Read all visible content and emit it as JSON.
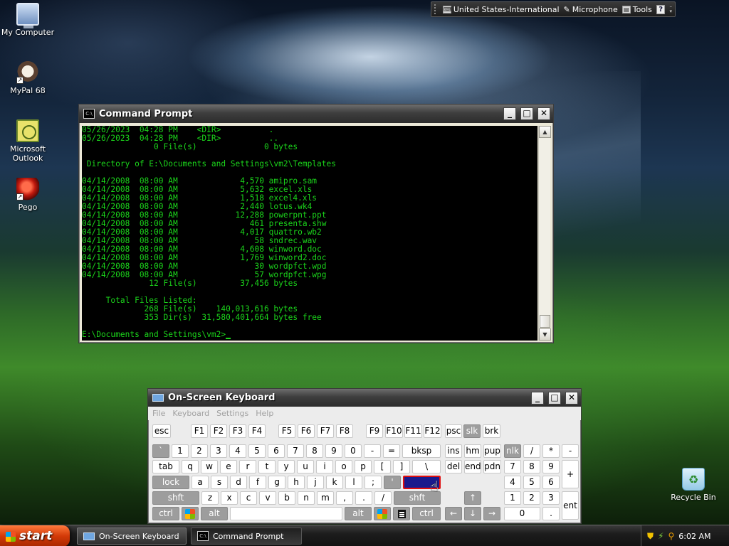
{
  "language_bar": {
    "language": "United States-International",
    "microphone": "Microphone",
    "tools": "Tools",
    "help_glyph": "?"
  },
  "desktop_icons": [
    {
      "label": "My Computer"
    },
    {
      "label": "MyPal 68"
    },
    {
      "label": "Microsoft Outlook"
    },
    {
      "label": "Pego"
    },
    {
      "label": "Recycle Bin"
    }
  ],
  "cmd": {
    "title": "Command Prompt",
    "icon_text": "C:\\",
    "lines": [
      "05/26/2023  04:28 PM    <DIR>          .",
      "05/26/2023  04:28 PM    <DIR>          ..",
      "               0 File(s)              0 bytes",
      "",
      " Directory of E:\\Documents and Settings\\vm2\\Templates",
      "",
      "04/14/2008  08:00 AM             4,570 amipro.sam",
      "04/14/2008  08:00 AM             5,632 excel.xls",
      "04/14/2008  08:00 AM             1,518 excel4.xls",
      "04/14/2008  08:00 AM             2,440 lotus.wk4",
      "04/14/2008  08:00 AM            12,288 powerpnt.ppt",
      "04/14/2008  08:00 AM               461 presenta.shw",
      "04/14/2008  08:00 AM             4,017 quattro.wb2",
      "04/14/2008  08:00 AM                58 sndrec.wav",
      "04/14/2008  08:00 AM             4,608 winword.doc",
      "04/14/2008  08:00 AM             1,769 winword2.doc",
      "04/14/2008  08:00 AM                30 wordpfct.wpd",
      "04/14/2008  08:00 AM                57 wordpfct.wpg",
      "              12 File(s)         37,456 bytes",
      "",
      "     Total Files Listed:",
      "             268 File(s)    140,013,616 bytes",
      "             353 Dir(s)  31,580,401,664 bytes free",
      "",
      "E:\\Documents and Settings\\vm2>"
    ]
  },
  "osk": {
    "title": "On-Screen Keyboard",
    "menu": [
      "File",
      "Keyboard",
      "Settings",
      "Help"
    ],
    "keys": {
      "esc": "esc",
      "f1": "F1",
      "f2": "F2",
      "f3": "F3",
      "f4": "F4",
      "f5": "F5",
      "f6": "F6",
      "f7": "F7",
      "f8": "F8",
      "f9": "F9",
      "f10": "F10",
      "f11": "F11",
      "f12": "F12",
      "psc": "psc",
      "slk": "slk",
      "brk": "brk",
      "backtick": "`",
      "n1": "1",
      "n2": "2",
      "n3": "3",
      "n4": "4",
      "n5": "5",
      "n6": "6",
      "n7": "7",
      "n8": "8",
      "n9": "9",
      "n0": "0",
      "minus": "-",
      "equals": "=",
      "bksp": "bksp",
      "ins": "ins",
      "hm": "hm",
      "pup": "pup",
      "nlk": "nlk",
      "np_slash": "/",
      "np_star": "*",
      "np_minus": "-",
      "tab": "tab",
      "q": "q",
      "w": "w",
      "e": "e",
      "r": "r",
      "t": "t",
      "y": "y",
      "u": "u",
      "i": "i",
      "o": "o",
      "p": "p",
      "lbracket": "[",
      "rbracket": "]",
      "backslash": "\\",
      "del": "del",
      "end": "end",
      "pdn": "pdn",
      "np7": "7",
      "np8": "8",
      "np9": "9",
      "np_plus": "+",
      "lock": "lock",
      "a": "a",
      "s": "s",
      "d": "d",
      "f": "f",
      "g": "g",
      "h": "h",
      "j": "j",
      "k": "k",
      "l": "l",
      "semicolon": ";",
      "quote": "'",
      "enter": "ent",
      "np4": "4",
      "np5": "5",
      "np6": "6",
      "shft_l": "shft",
      "z": "z",
      "x": "x",
      "c": "c",
      "v": "v",
      "b": "b",
      "n": "n",
      "m": "m",
      "comma": ",",
      "period": ".",
      "slash": "/",
      "shft_r": "shft",
      "up": "↑",
      "np1": "1",
      "np2": "2",
      "np3": "3",
      "np_ent": "ent",
      "ctrl_l": "ctrl",
      "alt_l": "alt",
      "alt_r": "alt",
      "ctrl_r": "ctrl",
      "left": "←",
      "down": "↓",
      "right": "→",
      "np0": "0",
      "np_dot": "."
    }
  },
  "taskbar": {
    "start": "start",
    "tasks": [
      "On-Screen Keyboard",
      "Command Prompt"
    ],
    "clock": "6:02 AM"
  },
  "colors": {
    "console_text": "#1bd41b",
    "console_bg": "#000000",
    "start_orange": "#d33a08",
    "key_highlight": "#1a1a8c",
    "key_highlight_border": "#e01010"
  }
}
